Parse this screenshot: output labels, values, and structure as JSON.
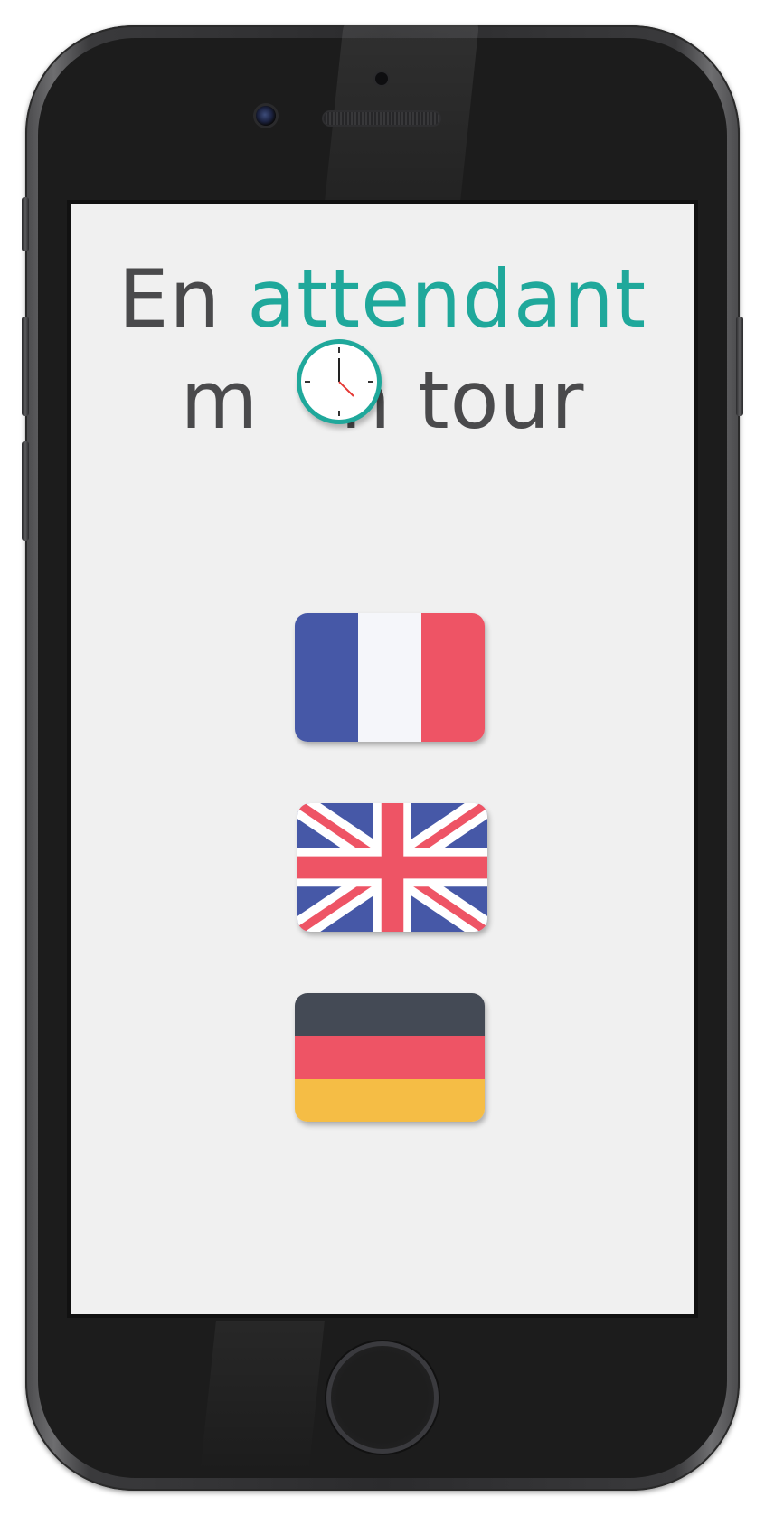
{
  "app": {
    "title_word_1": "En",
    "title_word_2": "attendant",
    "title_line2_start": "m",
    "title_line2_end": "n tour",
    "accent_color": "#1fa89b",
    "text_color": "#4a4a4c",
    "background_color": "#f0f0f0"
  },
  "clock_icon": {
    "name": "clock-icon",
    "hour": 5,
    "minute": 0,
    "hand_color": "#e53935"
  },
  "languages": [
    {
      "name": "french-flag",
      "colors": [
        "#4658a7",
        "#f5f6fa",
        "#ee5465"
      ]
    },
    {
      "name": "uk-flag",
      "colors": [
        "#4658a7",
        "#ffffff",
        "#ee5465"
      ]
    },
    {
      "name": "german-flag",
      "colors": [
        "#444a55",
        "#ee5465",
        "#f5bd45"
      ]
    }
  ],
  "device": {
    "home_button_icon": "home-button-icon"
  }
}
